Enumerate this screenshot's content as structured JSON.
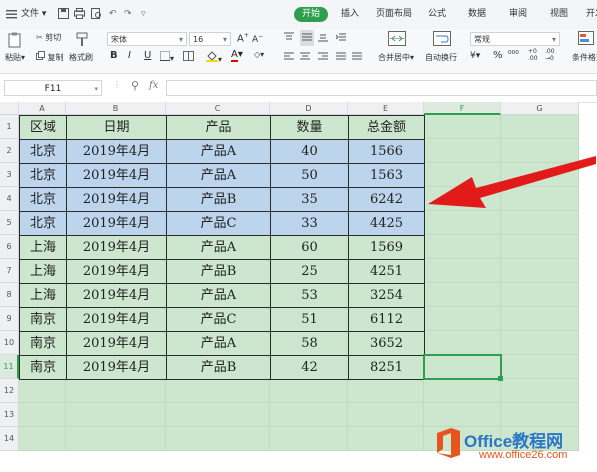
{
  "menubar": {
    "file_label": "文件",
    "tabs": [
      "开始",
      "插入",
      "页面布局",
      "公式",
      "数据",
      "审阅",
      "视图",
      "开发"
    ],
    "active_tab": "开始"
  },
  "ribbon": {
    "paste_label": "粘贴",
    "cut_label": "剪切",
    "copy_label": "复制",
    "format_painter_label": "格式刷",
    "font_name": "宋体",
    "font_size": "16",
    "merge_center_label": "合并居中",
    "wrap_text_label": "自动换行",
    "number_format": "常规",
    "conditional_format_label": "条件格式"
  },
  "formula": {
    "name_box": "F11",
    "fx_label": "fx",
    "value": ""
  },
  "sheet": {
    "columns": [
      "A",
      "B",
      "C",
      "D",
      "E",
      "F",
      "G"
    ],
    "rows": [
      "1",
      "2",
      "3",
      "4",
      "5",
      "6",
      "7",
      "8",
      "9",
      "10",
      "11",
      "12",
      "13",
      "14"
    ],
    "header": [
      "区域",
      "日期",
      "产品",
      "数量",
      "总金额"
    ],
    "data": [
      [
        "北京",
        "2019年4月",
        "产品A",
        "40",
        "1566"
      ],
      [
        "北京",
        "2019年4月",
        "产品A",
        "50",
        "1563"
      ],
      [
        "北京",
        "2019年4月",
        "产品B",
        "35",
        "6242"
      ],
      [
        "北京",
        "2019年4月",
        "产品C",
        "33",
        "4425"
      ],
      [
        "上海",
        "2019年4月",
        "产品A",
        "60",
        "1569"
      ],
      [
        "上海",
        "2019年4月",
        "产品B",
        "25",
        "4251"
      ],
      [
        "上海",
        "2019年4月",
        "产品A",
        "53",
        "3254"
      ],
      [
        "南京",
        "2019年4月",
        "产品C",
        "51",
        "6112"
      ],
      [
        "南京",
        "2019年4月",
        "产品A",
        "58",
        "3652"
      ],
      [
        "南京",
        "2019年4月",
        "产品B",
        "42",
        "8251"
      ]
    ],
    "highlighted_rows": [
      1,
      2,
      3,
      4
    ],
    "selected_cell": "F11"
  },
  "watermark": {
    "brand": "Office教程网",
    "url": "www.office26.com"
  },
  "colors": {
    "sheet_green": "#cde7cf",
    "highlight_blue": "#bcd5ec",
    "active_tab": "#2e9f4f",
    "arrow_red": "#e31a1a",
    "logo_orange": "#e8541e"
  }
}
